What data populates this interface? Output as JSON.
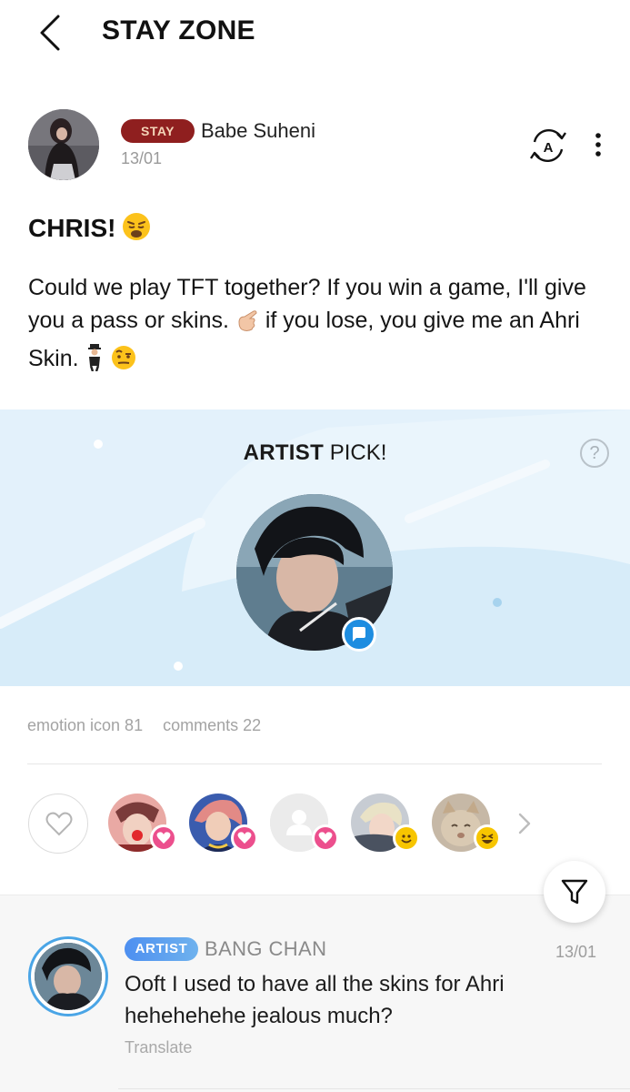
{
  "header": {
    "title": "STAY ZONE",
    "back_icon": "back-arrow-icon"
  },
  "post": {
    "badge": "STAY",
    "author": "Babe Suheni",
    "date": "13/01",
    "title": "CHRIS!",
    "body_part1": "Could we play TFT together? If you win a game, I'll give you a pass or skins.",
    "body_part2": "if you lose, you give me an Ahri Skin.",
    "icons": [
      "weary-face-emoji",
      "pointing-hand-emoji",
      "man-in-suit-emoji",
      "raised-eyebrow-emoji",
      "translate-icon",
      "more-vertical-icon"
    ]
  },
  "artist_pick": {
    "heading_bold": "ARTIST",
    "heading_rest": "PICK!",
    "help": "?"
  },
  "stats": {
    "emotion_label": "emotion icon 81",
    "comments_label": "comments 22"
  },
  "reactions": {
    "items": [
      {
        "badge": "heart",
        "color": "#ec4f8d"
      },
      {
        "badge": "heart",
        "color": "#ec4f8d"
      },
      {
        "badge": "heart",
        "color": "#ec4f8d"
      },
      {
        "badge": "smile",
        "color": "#f7c500"
      },
      {
        "badge": "laugh",
        "color": "#f7c500"
      }
    ]
  },
  "comment": {
    "badge": "ARTIST",
    "author": "BANG CHAN",
    "date": "13/01",
    "text": "Ooft I used to have all the skins for Ahri hehehehehe jealous much?",
    "translate": "Translate"
  },
  "colors": {
    "stay_badge": "#8f1f1f",
    "artist_badge": "#4d8ff0",
    "banner_bg": "#e3f1fb",
    "accent_blue": "#1e8de0"
  }
}
